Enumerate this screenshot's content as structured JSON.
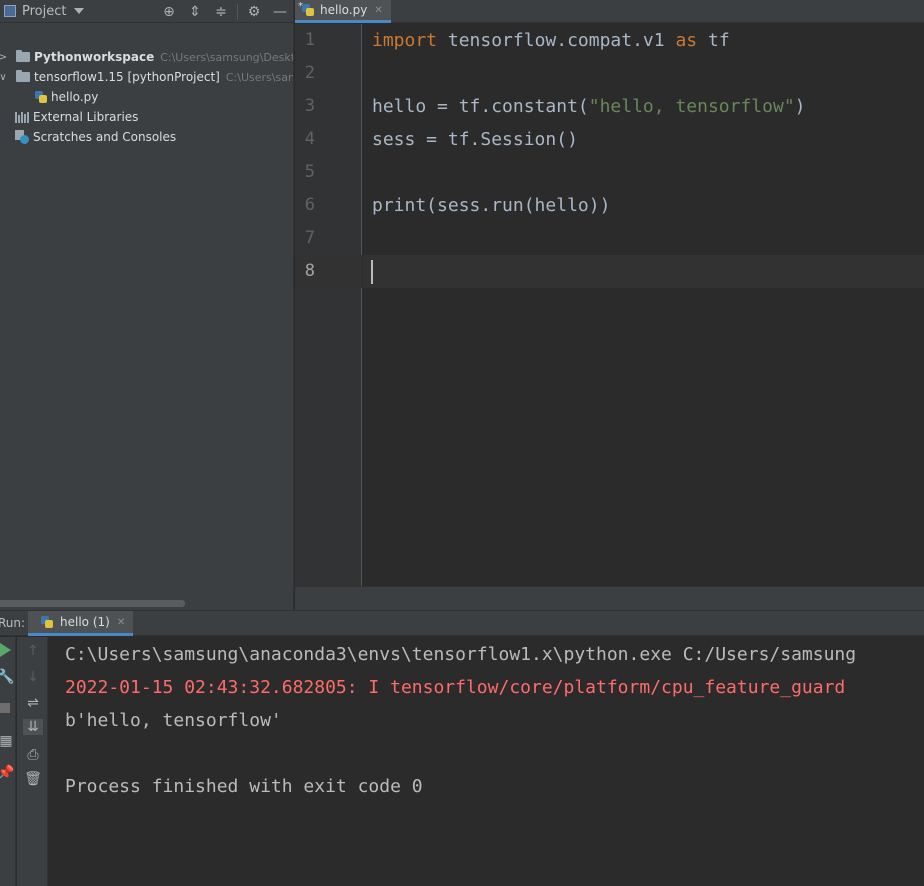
{
  "project_panel": {
    "title": "Project",
    "tree": [
      {
        "name": "Pythonworkspace",
        "path": "C:\\Users\\samsung\\Desktop"
      },
      {
        "name": "tensorflow1.15 [pythonProject]",
        "path": "C:\\Users\\samsung"
      },
      {
        "name": "hello.py"
      },
      {
        "name": "External Libraries"
      },
      {
        "name": "Scratches and Consoles"
      }
    ]
  },
  "editor": {
    "tab_label": "hello.py",
    "modified_marker": "*",
    "line_numbers": [
      "1",
      "2",
      "3",
      "4",
      "5",
      "6",
      "7",
      "8"
    ],
    "lines": [
      {
        "kw1": "import",
        "t1": " tensorflow.compat.v1 ",
        "kw2": "as",
        "t2": " tf"
      },
      {},
      {
        "t1": "hello = tf.constant(",
        "str": "\"hello, tensorflow\"",
        "t2": ")"
      },
      {
        "t1": "sess = tf.Session()"
      },
      {},
      {
        "t1": "print(sess.run(hello))"
      },
      {},
      {}
    ],
    "current_line": 8
  },
  "run_panel": {
    "label": "Run:",
    "tab_label": "hello (1)",
    "output": [
      {
        "text": "C:\\Users\\samsung\\anaconda3\\envs\\tensorflow1.x\\python.exe C:/Users/samsung",
        "type": "normal"
      },
      {
        "text": "2022-01-15 02:43:32.682805: I tensorflow/core/platform/cpu_feature_guard",
        "type": "error"
      },
      {
        "text": "b'hello, tensorflow'",
        "type": "normal"
      },
      {
        "text": "",
        "type": "normal"
      },
      {
        "text": "Process finished with exit code 0",
        "type": "normal"
      }
    ]
  },
  "colors": {
    "keyword": "#cc7832",
    "string": "#6a8759",
    "stderr": "#ff6b68",
    "accent": "#4a88c7"
  }
}
